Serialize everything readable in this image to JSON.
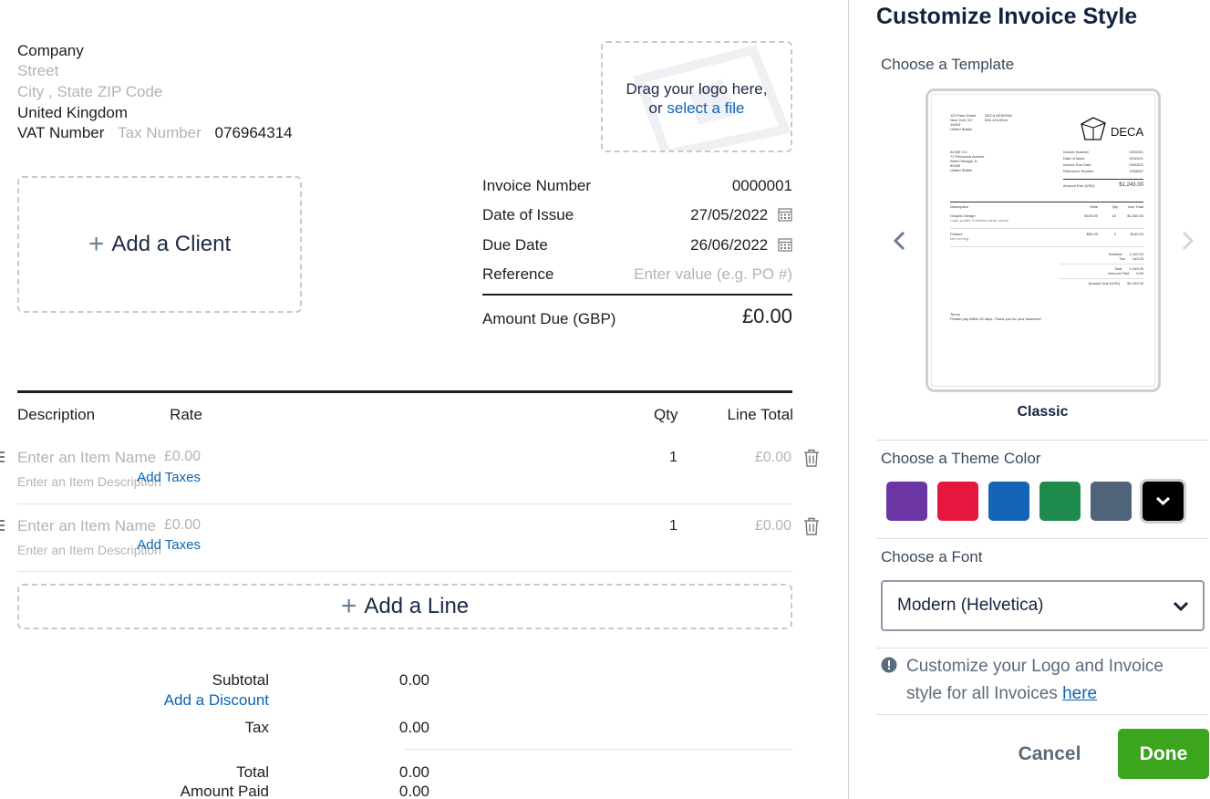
{
  "company": {
    "name": "Company",
    "street_placeholder": "Street",
    "city_placeholder": "City , State ZIP Code",
    "country": "United Kingdom",
    "vat_label": "VAT Number",
    "tax_placeholder": "Tax Number",
    "vat_value": "076964314"
  },
  "logo": {
    "drag_text": "Drag your logo here,",
    "or_text": "or",
    "select_link": "select a file"
  },
  "client": {
    "add_label": "Add a Client"
  },
  "meta": {
    "invoice_number_label": "Invoice Number",
    "invoice_number": "0000001",
    "date_of_issue_label": "Date of Issue",
    "date_of_issue": "27/05/2022",
    "due_date_label": "Due Date",
    "due_date": "26/06/2022",
    "reference_label": "Reference",
    "reference_placeholder": "Enter value (e.g. PO #)",
    "amount_due_label": "Amount Due (GBP)",
    "amount_due": "£0.00"
  },
  "table": {
    "headers": {
      "description": "Description",
      "rate": "Rate",
      "qty": "Qty",
      "line_total": "Line Total"
    },
    "rows": [
      {
        "name_placeholder": "Enter an Item Name",
        "desc_placeholder": "Enter an Item Description",
        "rate": "£0.00",
        "add_taxes": "Add Taxes",
        "qty": "1",
        "line_total": "£0.00"
      },
      {
        "name_placeholder": "Enter an Item Name",
        "desc_placeholder": "Enter an Item Description",
        "rate": "£0.00",
        "add_taxes": "Add Taxes",
        "qty": "1",
        "line_total": "£0.00"
      }
    ],
    "add_line": "Add a Line"
  },
  "totals": {
    "subtotal_label": "Subtotal",
    "subtotal": "0.00",
    "add_discount": "Add a Discount",
    "tax_label": "Tax",
    "tax": "0.00",
    "total_label": "Total",
    "total": "0.00",
    "amount_paid_label": "Amount Paid",
    "amount_paid": "0.00"
  },
  "panel": {
    "title": "Customize Invoice Style",
    "template_label": "Choose a Template",
    "template_name": "Classic",
    "theme_label": "Choose a Theme Color",
    "theme_colors": [
      "#6b35a3",
      "#e5173f",
      "#1565b7",
      "#1e8a4c",
      "#4f6479",
      "#000000"
    ],
    "selected_color_index": 5,
    "font_label": "Choose a Font",
    "font_value": "Modern (Helvetica)",
    "info_text": "Customize your Logo and Invoice style for all Invoices",
    "info_link": "here",
    "cancel": "Cancel",
    "done": "Done"
  },
  "preview": {
    "from_lines": [
      "123 Fake Street",
      "New York, NY",
      "10003",
      "United States"
    ],
    "company_name": "DECA DESIGNS",
    "phone": "555-123-5344",
    "logo_text": "DECA",
    "to_lines": [
      "ACME CO.",
      "71 Pinewood Avenue",
      "West Chicago, IL",
      "60185",
      "United States"
    ],
    "meta": [
      [
        "Invoice Number",
        "0000001"
      ],
      [
        "Date of Issue",
        "02/03/21"
      ],
      [
        "Invoice Due Date",
        "03/03/21"
      ],
      [
        "Reference Number",
        "1928657"
      ]
    ],
    "amount_due_label": "Amount Due (USD)",
    "amount_due": "$1,243.00",
    "headers": [
      "Description",
      "Rate",
      "Qty",
      "Line Total"
    ],
    "items": [
      {
        "name": "Graphic Design",
        "desc": "Logo, poster, business cards, stamp",
        "rate": "$100.00",
        "qty": "10",
        "total": "$1,000.00"
      },
      {
        "name": "Posters",
        "desc": "Idrn printng",
        "rate": "$50.00",
        "qty": "2",
        "total": "$100.00"
      }
    ],
    "totals": [
      [
        "Subtotal",
        "1,100.00"
      ],
      [
        "Tax",
        "143.00"
      ],
      [
        "Total",
        "1,243.00"
      ],
      [
        "Amount Paid",
        "0.00"
      ]
    ],
    "amount_due_row_label": "Amount Due (USD)",
    "amount_due_row": "$1,243.00",
    "terms_label": "Terms",
    "terms_text": "Please pay within 30 days. Thank you for your business!"
  }
}
